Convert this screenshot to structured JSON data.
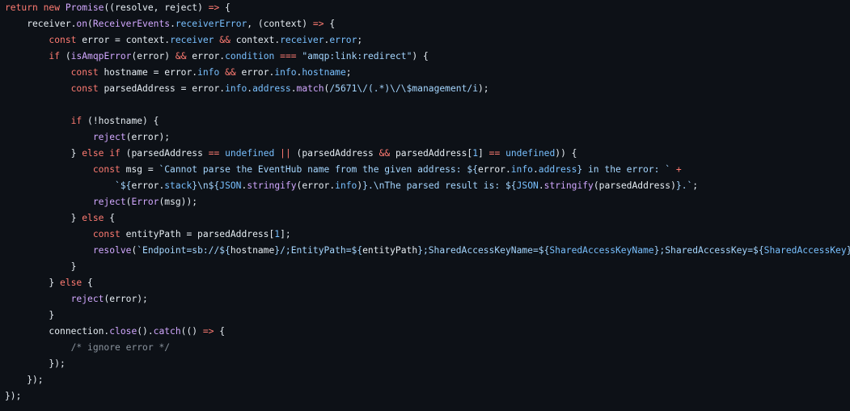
{
  "editor": {
    "language": "javascript",
    "colors": {
      "background": "#0d1117",
      "plain": "#e6edf3",
      "keyword": "#ff7b72",
      "function": "#d2a8ff",
      "property": "#79c0ff",
      "string": "#a5d6ff",
      "number": "#79c0ff",
      "comment": "#8b949e"
    },
    "lines": [
      [
        [
          "kw",
          "return"
        ],
        [
          "p",
          " "
        ],
        [
          "kw",
          "new"
        ],
        [
          "p",
          " "
        ],
        [
          "fn",
          "Promise"
        ],
        [
          "p",
          "((resolve, reject) "
        ],
        [
          "kw",
          "=>"
        ],
        [
          "p",
          " {"
        ]
      ],
      [
        [
          "p",
          "    receiver."
        ],
        [
          "fn",
          "on"
        ],
        [
          "p",
          "("
        ],
        [
          "fn",
          "ReceiverEvents"
        ],
        [
          "p",
          "."
        ],
        [
          "prop",
          "receiverError"
        ],
        [
          "p",
          ", (context) "
        ],
        [
          "kw",
          "=>"
        ],
        [
          "p",
          " {"
        ]
      ],
      [
        [
          "p",
          "        "
        ],
        [
          "kw",
          "const"
        ],
        [
          "p",
          " error = context."
        ],
        [
          "prop",
          "receiver"
        ],
        [
          "p",
          " "
        ],
        [
          "kw",
          "&&"
        ],
        [
          "p",
          " context."
        ],
        [
          "prop",
          "receiver"
        ],
        [
          "p",
          "."
        ],
        [
          "prop",
          "error"
        ],
        [
          "p",
          ";"
        ]
      ],
      [
        [
          "p",
          "        "
        ],
        [
          "kw",
          "if"
        ],
        [
          "p",
          " ("
        ],
        [
          "fn",
          "isAmqpError"
        ],
        [
          "p",
          "(error) "
        ],
        [
          "kw",
          "&&"
        ],
        [
          "p",
          " error."
        ],
        [
          "prop",
          "condition"
        ],
        [
          "p",
          " "
        ],
        [
          "kw",
          "==="
        ],
        [
          "p",
          " "
        ],
        [
          "str",
          "\"amqp:link:redirect\""
        ],
        [
          "p",
          ") {"
        ]
      ],
      [
        [
          "p",
          "            "
        ],
        [
          "kw",
          "const"
        ],
        [
          "p",
          " hostname = error."
        ],
        [
          "prop",
          "info"
        ],
        [
          "p",
          " "
        ],
        [
          "kw",
          "&&"
        ],
        [
          "p",
          " error."
        ],
        [
          "prop",
          "info"
        ],
        [
          "p",
          "."
        ],
        [
          "prop",
          "hostname"
        ],
        [
          "p",
          ";"
        ]
      ],
      [
        [
          "p",
          "            "
        ],
        [
          "kw",
          "const"
        ],
        [
          "p",
          " parsedAddress = error."
        ],
        [
          "prop",
          "info"
        ],
        [
          "p",
          "."
        ],
        [
          "prop",
          "address"
        ],
        [
          "p",
          "."
        ],
        [
          "fn",
          "match"
        ],
        [
          "p",
          "("
        ],
        [
          "str",
          "/5671\\/(.*)\\/\\$management/i"
        ],
        [
          "p",
          ");"
        ]
      ],
      [],
      [
        [
          "p",
          "            "
        ],
        [
          "kw",
          "if"
        ],
        [
          "p",
          " (!hostname) {"
        ]
      ],
      [
        [
          "p",
          "                "
        ],
        [
          "fn",
          "reject"
        ],
        [
          "p",
          "(error);"
        ]
      ],
      [
        [
          "p",
          "            } "
        ],
        [
          "kw",
          "else"
        ],
        [
          "p",
          " "
        ],
        [
          "kw",
          "if"
        ],
        [
          "p",
          " (parsedAddress "
        ],
        [
          "kw",
          "=="
        ],
        [
          "p",
          " "
        ],
        [
          "num",
          "undefined"
        ],
        [
          "p",
          " "
        ],
        [
          "kw",
          "||"
        ],
        [
          "p",
          " (parsedAddress "
        ],
        [
          "kw",
          "&&"
        ],
        [
          "p",
          " parsedAddress["
        ],
        [
          "num",
          "1"
        ],
        [
          "p",
          "] "
        ],
        [
          "kw",
          "=="
        ],
        [
          "p",
          " "
        ],
        [
          "num",
          "undefined"
        ],
        [
          "p",
          ")) {"
        ]
      ],
      [
        [
          "p",
          "                "
        ],
        [
          "kw",
          "const"
        ],
        [
          "p",
          " msg = "
        ],
        [
          "str",
          "`Cannot parse the EventHub name from the given address: ${"
        ],
        [
          "p",
          "error."
        ],
        [
          "prop",
          "info"
        ],
        [
          "p",
          "."
        ],
        [
          "prop",
          "address"
        ],
        [
          "str",
          "} in the error: `"
        ],
        [
          "p",
          " "
        ],
        [
          "kw",
          "+"
        ]
      ],
      [
        [
          "p",
          "                    "
        ],
        [
          "str",
          "`${"
        ],
        [
          "p",
          "error."
        ],
        [
          "prop",
          "stack"
        ],
        [
          "str",
          "}\\n${"
        ],
        [
          "prop",
          "JSON"
        ],
        [
          "p",
          "."
        ],
        [
          "fn",
          "stringify"
        ],
        [
          "p",
          "(error."
        ],
        [
          "prop",
          "info"
        ],
        [
          "p",
          ")"
        ],
        [
          "str",
          "}.\\nThe parsed result is: ${"
        ],
        [
          "prop",
          "JSON"
        ],
        [
          "p",
          "."
        ],
        [
          "fn",
          "stringify"
        ],
        [
          "p",
          "(parsedAddress)"
        ],
        [
          "str",
          "}.`"
        ],
        [
          "p",
          ";"
        ]
      ],
      [
        [
          "p",
          "                "
        ],
        [
          "fn",
          "reject"
        ],
        [
          "p",
          "("
        ],
        [
          "fn",
          "Error"
        ],
        [
          "p",
          "(msg));"
        ]
      ],
      [
        [
          "p",
          "            } "
        ],
        [
          "kw",
          "else"
        ],
        [
          "p",
          " {"
        ]
      ],
      [
        [
          "p",
          "                "
        ],
        [
          "kw",
          "const"
        ],
        [
          "p",
          " entityPath = parsedAddress["
        ],
        [
          "num",
          "1"
        ],
        [
          "p",
          "];"
        ]
      ],
      [
        [
          "p",
          "                "
        ],
        [
          "fn",
          "resolve"
        ],
        [
          "p",
          "("
        ],
        [
          "str",
          "`Endpoint=sb://${"
        ],
        [
          "p",
          "hostname"
        ],
        [
          "str",
          "}/;EntityPath=${"
        ],
        [
          "p",
          "entityPath"
        ],
        [
          "str",
          "};SharedAccessKeyName=${"
        ],
        [
          "prop",
          "SharedAccessKeyName"
        ],
        [
          "str",
          "};SharedAccessKey=${"
        ],
        [
          "prop",
          "SharedAccessKey"
        ],
        [
          "str",
          "}`"
        ],
        [
          "p",
          ");"
        ]
      ],
      [
        [
          "p",
          "            }"
        ]
      ],
      [
        [
          "p",
          "        } "
        ],
        [
          "kw",
          "else"
        ],
        [
          "p",
          " {"
        ]
      ],
      [
        [
          "p",
          "            "
        ],
        [
          "fn",
          "reject"
        ],
        [
          "p",
          "(error);"
        ]
      ],
      [
        [
          "p",
          "        }"
        ]
      ],
      [
        [
          "p",
          "        connection."
        ],
        [
          "fn",
          "close"
        ],
        [
          "p",
          "()."
        ],
        [
          "fn",
          "catch"
        ],
        [
          "p",
          "(() "
        ],
        [
          "kw",
          "=>"
        ],
        [
          "p",
          " {"
        ]
      ],
      [
        [
          "p",
          "            "
        ],
        [
          "cm",
          "/* ignore error */"
        ]
      ],
      [
        [
          "p",
          "        });"
        ]
      ],
      [
        [
          "p",
          "    });"
        ]
      ],
      [
        [
          "p",
          "});"
        ]
      ]
    ]
  }
}
